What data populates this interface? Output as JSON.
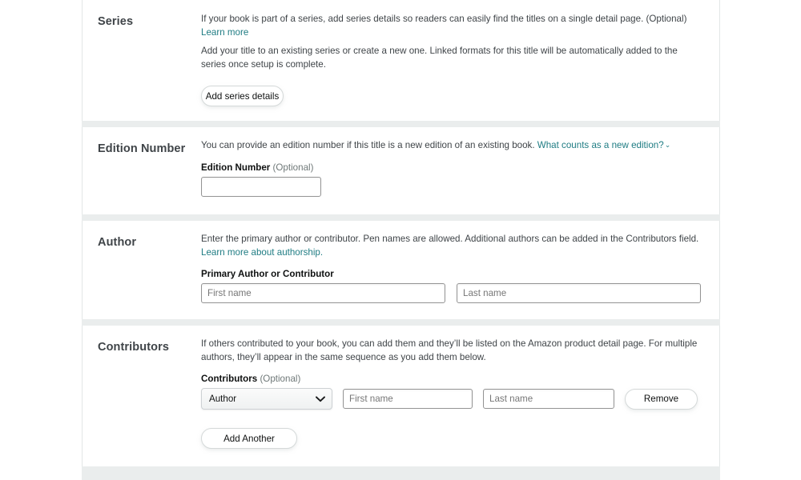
{
  "sections": [
    {
      "id": "series",
      "title": "Series",
      "desc_1_pre": "If your book is part of a series, add series details so readers can easily find the titles on a single detail page. (Optional) ",
      "desc_1_link": "Learn more",
      "desc_2": "Add your title to an existing series or create a new one. Linked formats for this title will be automatically added to the series once setup is complete.",
      "button": "Add series details"
    },
    {
      "id": "edition",
      "title": "Edition Number",
      "desc_pre": "You can provide an edition number if this title is a new edition of an existing book. ",
      "desc_link": "What counts as a new edition?",
      "chevron": "⌄",
      "field_label": "Edition Number",
      "field_optional": "(Optional)",
      "input_value": "",
      "input_placeholder": ""
    },
    {
      "id": "author",
      "title": "Author",
      "desc_pre": "Enter the primary author or contributor. Pen names are allowed. Additional authors can be added in the Contributors field. ",
      "desc_link": "Learn more about authorship.",
      "field_label": "Primary Author or Contributor",
      "first_name_value": "",
      "first_name_placeholder": "First name",
      "last_name_value": "",
      "last_name_placeholder": "Last name"
    },
    {
      "id": "contributors",
      "title": "Contributors",
      "desc": "If others contributed to your book, you can add them and they’ll be listed on the Amazon product detail page. For multiple authors, they’ll appear in the same sequence as you add them below.",
      "field_label": "Contributors",
      "field_optional": "(Optional)",
      "role_selected": "Author",
      "role_options": [
        "Author"
      ],
      "first_name_value": "",
      "first_name_placeholder": "First name",
      "last_name_value": "",
      "last_name_placeholder": "Last name",
      "remove_button": "Remove",
      "add_another_button": "Add Another"
    }
  ],
  "colors": {
    "link": "#1f7c83",
    "page_bg": "#ffffff",
    "card_gap": "#eaeded",
    "section_bg": "#ffffff",
    "border": "#e3e6e6",
    "input_border": "#949494",
    "text": "#0f1111",
    "muted": "#6f7878"
  }
}
